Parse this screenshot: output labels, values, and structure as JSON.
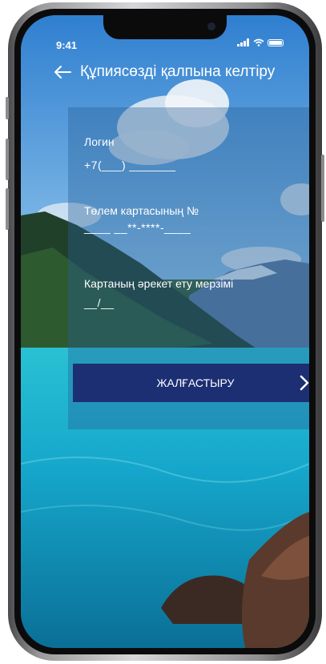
{
  "status_bar": {
    "time": "9:41",
    "signal_icon": "cellular-signal-icon",
    "wifi_icon": "wifi-icon",
    "battery_icon": "battery-icon"
  },
  "header": {
    "back_icon": "arrow-left-icon",
    "title": "Құпиясөзді қалпына келтіру"
  },
  "form": {
    "login": {
      "label": "Логин",
      "prefix": "+7(",
      "mask": "___) _______"
    },
    "card_number": {
      "label": "Төлем картасының №",
      "mask": "____ __**-****-____"
    },
    "expiry": {
      "label": "Картаның әрекет ету мерзімі",
      "mask": "__/__"
    },
    "submit_label": "ЖАЛҒАСТЫРУ",
    "submit_icon": "chevron-right-icon"
  },
  "colors": {
    "button_bg": "#1d2f73",
    "panel_bg": "rgba(40,95,150,0.38)",
    "text": "#ffffff"
  }
}
